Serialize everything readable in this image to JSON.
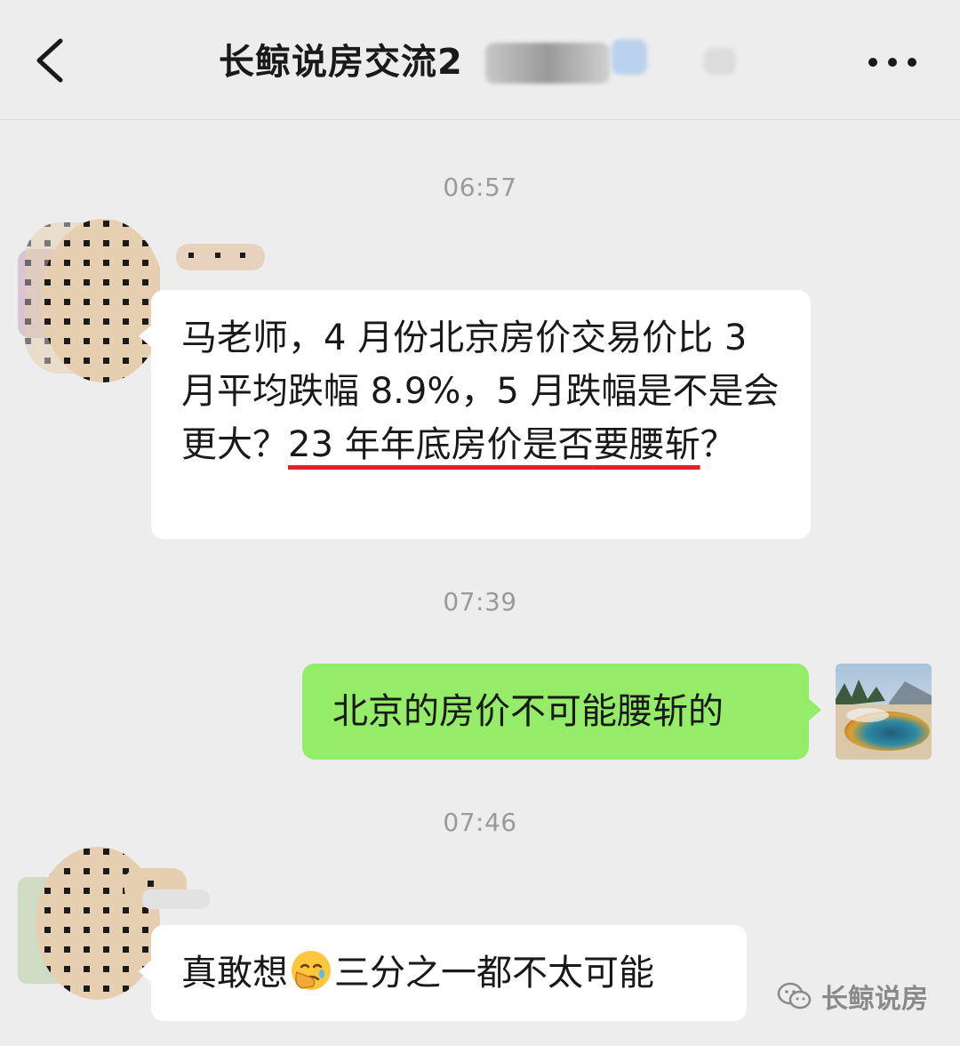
{
  "header": {
    "title": "长鲸说房交流2",
    "back_icon": "chevron-left-icon",
    "more_icon": "more-dots-icon"
  },
  "messages": [
    {
      "time": "06:57",
      "side": "left",
      "text_part1": "马老师，4 月份北京房价交易价比 3 月平均跌幅 8.9%，5 月跌幅是不是会更大？",
      "text_underlined_a": "23 年年底房价是否",
      "text_underlined_b": "要腰斩",
      "text_tail": "？"
    },
    {
      "time": "07:39",
      "side": "right",
      "text": "北京的房价不可能腰斩的"
    },
    {
      "time": "07:46",
      "side": "left",
      "text_before_emoji": "真敢想",
      "emoji": "facepalm-emoji",
      "text_after_emoji": "三分之一都不太可能"
    }
  ],
  "watermark": {
    "icon": "wechat-icon",
    "text": "长鲸说房"
  },
  "colors": {
    "background": "#ededed",
    "incoming_bubble": "#ffffff",
    "outgoing_bubble": "#95ec69",
    "underline": "#e0202a"
  }
}
